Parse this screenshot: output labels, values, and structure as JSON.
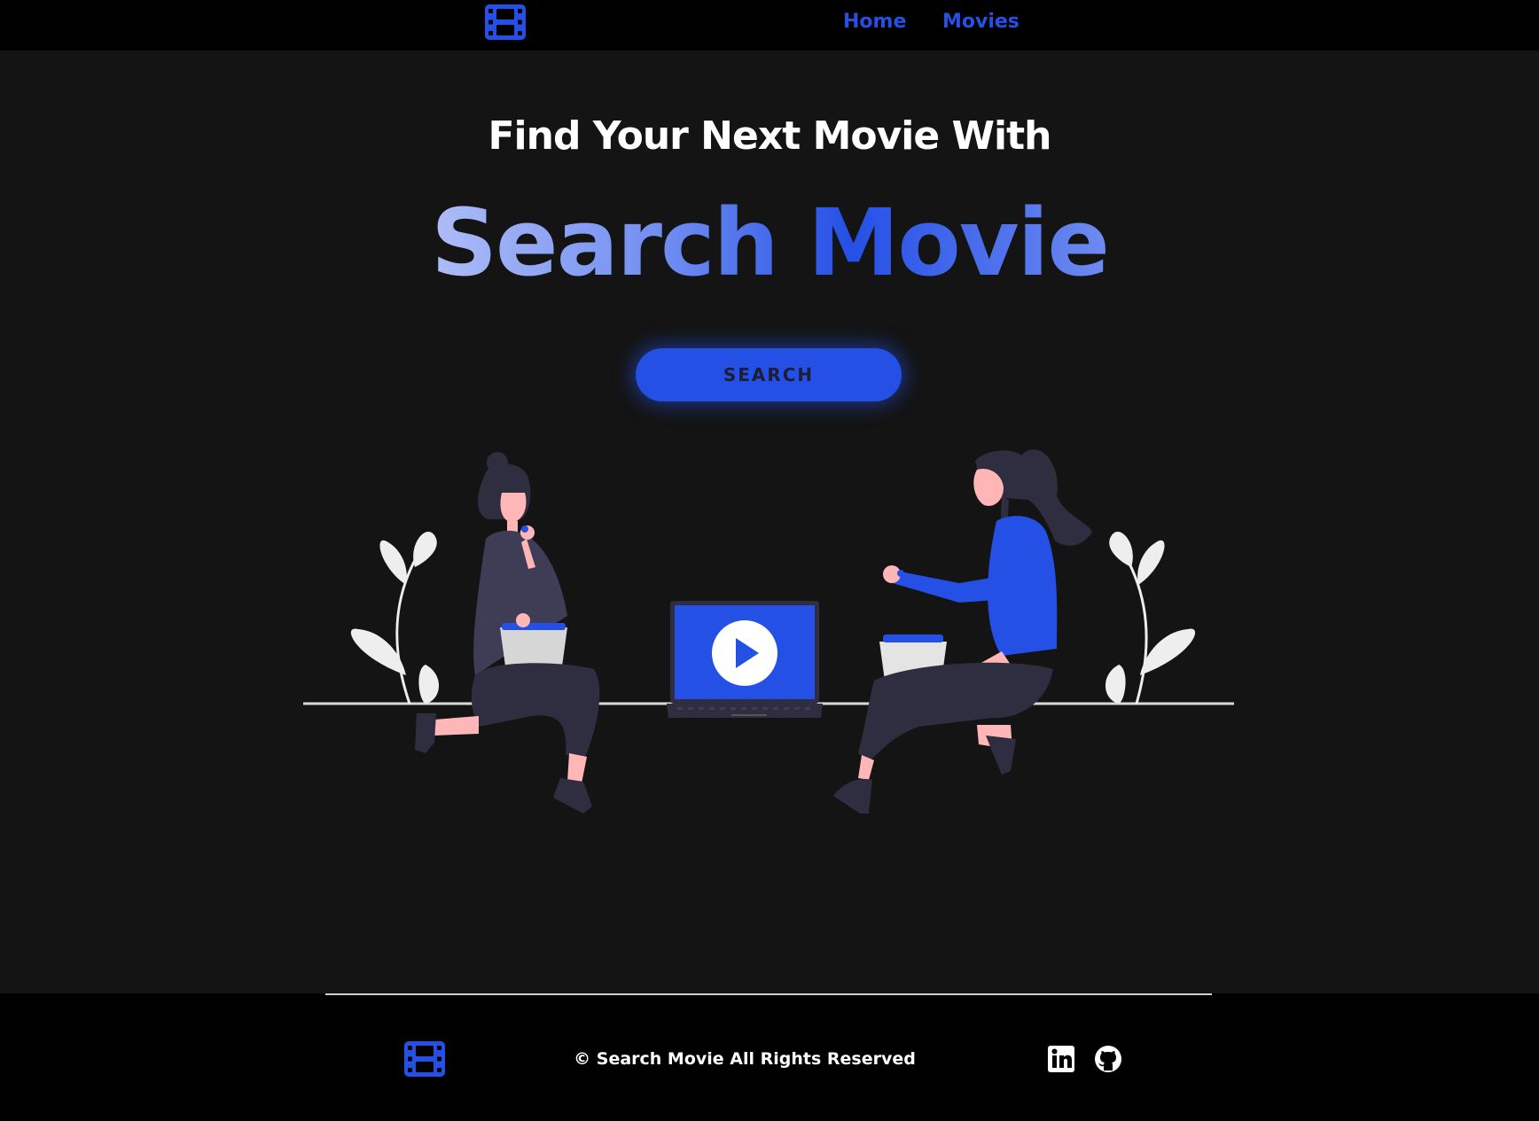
{
  "header": {
    "logo_icon": "film-icon",
    "nav": [
      {
        "label": "Home"
      },
      {
        "label": "Movies"
      }
    ]
  },
  "hero": {
    "subtitle": "Find Your Next Movie With",
    "title": "Search Movie",
    "button_label": "SEARCH",
    "illustration_icon": "people-watching-movie-illustration"
  },
  "footer": {
    "logo_icon": "film-icon",
    "copyright": "© Search Movie All Rights Reserved",
    "social": [
      {
        "icon": "linkedin-icon"
      },
      {
        "icon": "github-icon"
      }
    ]
  },
  "colors": {
    "background": "#141414",
    "bar": "#000000",
    "accent": "#2550e6"
  }
}
